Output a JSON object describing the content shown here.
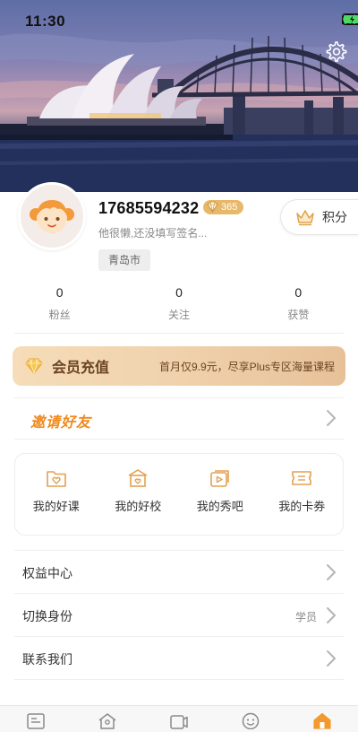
{
  "status_bar": {
    "time": "11:30",
    "icons": [
      "signal-icon",
      "wifi-icon",
      "battery-icon"
    ]
  },
  "header": {
    "background": "sydney-opera-house-photo",
    "settings_icon": "gear-icon"
  },
  "profile": {
    "phone": "17685594232",
    "vip_level": "365",
    "signature": "他很懒,还没填写签名...",
    "city": "青岛市",
    "points_label": "积分"
  },
  "stats": [
    {
      "value": "0",
      "label": "粉丝"
    },
    {
      "value": "0",
      "label": "关注"
    },
    {
      "value": "0",
      "label": "获赞"
    }
  ],
  "recharge": {
    "title": "会员充值",
    "description": "首月仅9.9元，尽享Plus专区海量课程"
  },
  "invite": {
    "label": "邀请好友"
  },
  "quick_links": [
    {
      "label": "我的好课",
      "icon": "folder-heart-icon"
    },
    {
      "label": "我的好校",
      "icon": "school-icon"
    },
    {
      "label": "我的秀吧",
      "icon": "video-icon"
    },
    {
      "label": "我的卡券",
      "icon": "ticket-icon"
    }
  ],
  "menu": [
    {
      "label": "权益中心",
      "value": ""
    },
    {
      "label": "切换身份",
      "value": "学员"
    },
    {
      "label": "联系我们",
      "value": ""
    }
  ],
  "tabbar": {
    "tabs": [
      "news-icon",
      "school-tab-icon",
      "video-tab-icon",
      "smile-icon",
      "home-icon"
    ],
    "active_index": 4
  },
  "colors": {
    "accent_orange": "#f08a1e",
    "vip_gold": "#e8b86a",
    "recharge_text": "#6b4423"
  }
}
